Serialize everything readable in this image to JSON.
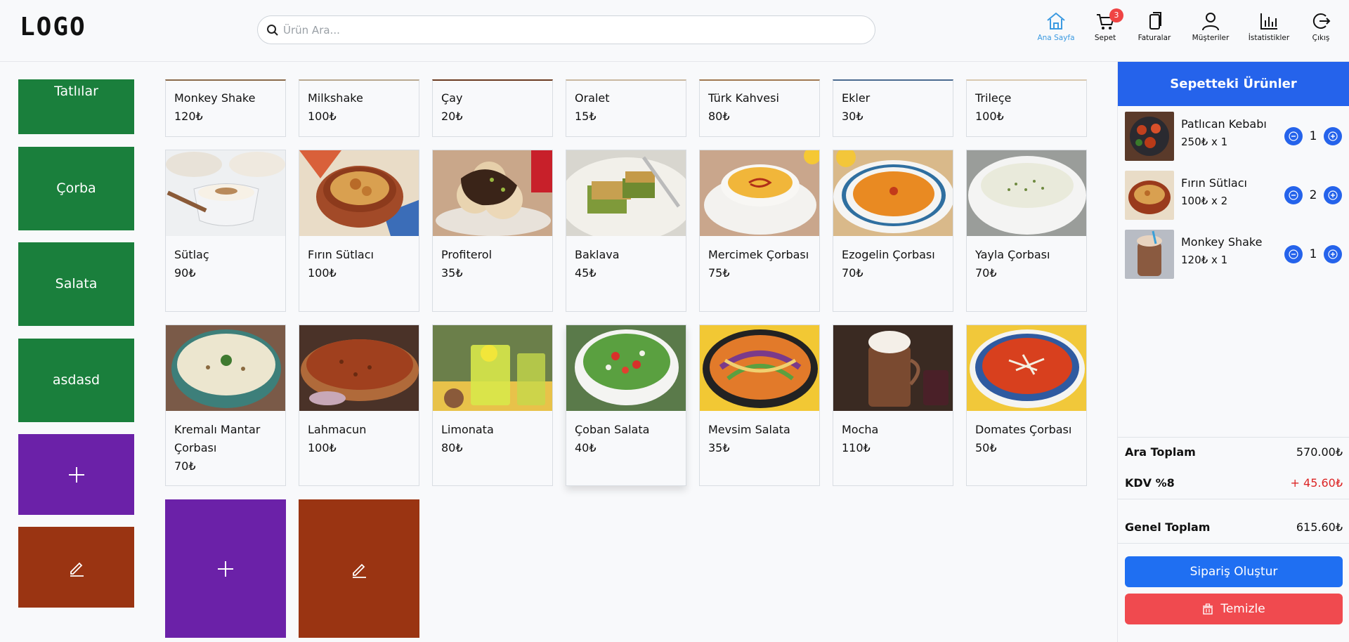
{
  "header": {
    "logo": "LOGO",
    "search_placeholder": "Ürün Ara...",
    "nav": [
      {
        "label": "Ana Sayfa",
        "icon": "home-icon",
        "active": true
      },
      {
        "label": "Sepet",
        "icon": "cart-icon",
        "badge": "3"
      },
      {
        "label": "Faturalar",
        "icon": "invoice-icon"
      },
      {
        "label": "Müşteriler",
        "icon": "user-icon"
      },
      {
        "label": "İstatistikler",
        "icon": "chart-icon"
      },
      {
        "label": "Çıkış",
        "icon": "logout-icon"
      }
    ]
  },
  "categories": [
    {
      "label": "Tatlılar"
    },
    {
      "label": "Çorba"
    },
    {
      "label": "Salata"
    },
    {
      "label": "asdasd"
    }
  ],
  "category_actions": {
    "add": "+",
    "edit_icon": "edit-icon"
  },
  "products": [
    {
      "name": "Monkey Shake",
      "price": "120₺"
    },
    {
      "name": "Milkshake",
      "price": "100₺"
    },
    {
      "name": "Çay",
      "price": "20₺"
    },
    {
      "name": "Oralet",
      "price": "15₺"
    },
    {
      "name": "Türk Kahvesi",
      "price": "80₺"
    },
    {
      "name": "Ekler",
      "price": "30₺"
    },
    {
      "name": "Trileçe",
      "price": "100₺"
    },
    {
      "name": "Sütlaç",
      "price": "90₺"
    },
    {
      "name": "Fırın Sütlacı",
      "price": "100₺"
    },
    {
      "name": "Profiterol",
      "price": "35₺"
    },
    {
      "name": "Baklava",
      "price": "45₺"
    },
    {
      "name": "Mercimek Çorbası",
      "price": "75₺"
    },
    {
      "name": "Ezogelin Çorbası",
      "price": "70₺"
    },
    {
      "name": "Yayla Çorbası",
      "price": "70₺"
    },
    {
      "name": "Kremalı Mantar Çorbası",
      "price": "70₺"
    },
    {
      "name": "Lahmacun",
      "price": "100₺"
    },
    {
      "name": "Limonata",
      "price": "80₺"
    },
    {
      "name": "Çoban Salata",
      "price": "40₺"
    },
    {
      "name": "Mevsim Salata",
      "price": "35₺"
    },
    {
      "name": "Mocha",
      "price": "110₺"
    },
    {
      "name": "Domates Çorbası",
      "price": "50₺"
    }
  ],
  "colors": {
    "category_green": "#1a7f3c",
    "add_purple": "#6b21a8",
    "edit_orange": "#9a3412",
    "primary_blue": "#2563eb",
    "danger_red": "#f04a4f",
    "kdv_red": "#dc2626"
  },
  "cart": {
    "title": "Sepetteki Ürünler",
    "items": [
      {
        "name": "Patlıcan Kebabı",
        "detail": "250₺ x 1",
        "qty": "1"
      },
      {
        "name": "Fırın Sütlacı",
        "detail": "100₺ x 2",
        "qty": "2"
      },
      {
        "name": "Monkey Shake",
        "detail": "120₺ x 1",
        "qty": "1"
      }
    ],
    "subtotal_label": "Ara Toplam",
    "subtotal": "570.00₺",
    "tax_label": "KDV %8",
    "tax": "+ 45.60₺",
    "total_label": "Genel Toplam",
    "total": "615.60₺",
    "create_order": "Sipariş Oluştur",
    "clear": "Temizle"
  }
}
